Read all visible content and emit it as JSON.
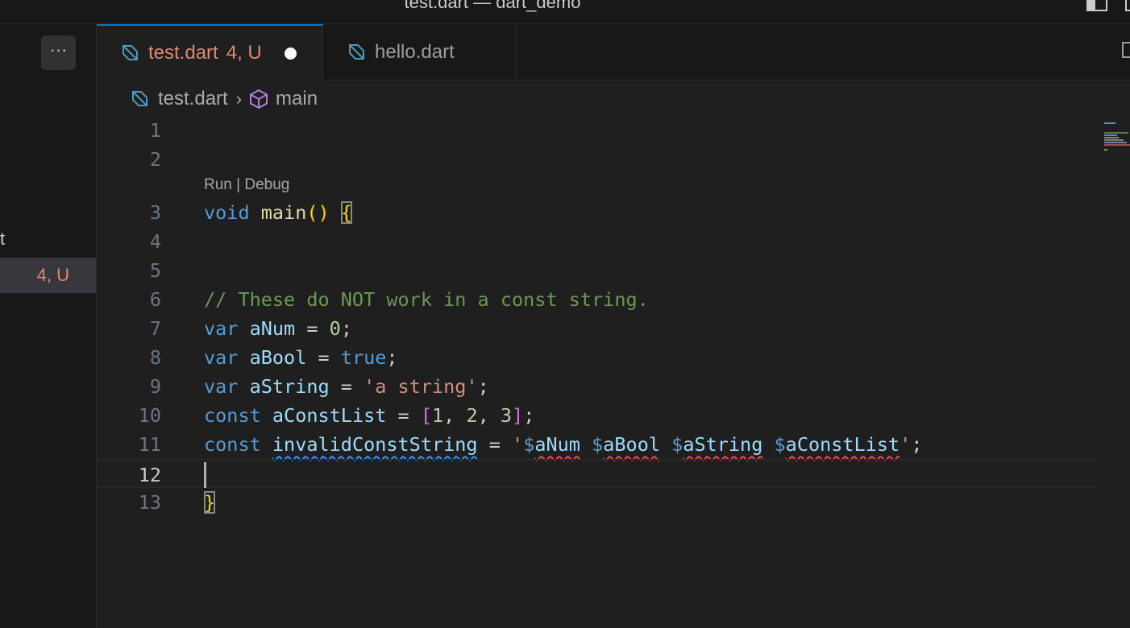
{
  "window": {
    "title": "test.dart — dart_demo"
  },
  "sidebar": {
    "more_label": "···",
    "fragment": "t",
    "item_status": "4, U"
  },
  "tabs": [
    {
      "label": "test.dart",
      "status": "4, U",
      "dirty": true,
      "active": true
    },
    {
      "label": "hello.dart",
      "active": false
    }
  ],
  "breadcrumb": {
    "file": "test.dart",
    "separator": "›",
    "symbol": "main"
  },
  "editor": {
    "codelens": "Run | Debug",
    "current_line": 12,
    "line_numbers": [
      "1",
      "2",
      "3",
      "4",
      "5",
      "6",
      "7",
      "8",
      "9",
      "10",
      "11",
      "12",
      "13"
    ],
    "code": {
      "l3": {
        "kw": "void",
        "fn": "main",
        "parens": "()",
        "brace": "{"
      },
      "l6": "// These do NOT work in a const string.",
      "l7": {
        "kw": "var",
        "name": "aNum",
        "eq": " = ",
        "value": "0",
        "end": ";"
      },
      "l8": {
        "kw": "var",
        "name": "aBool",
        "eq": " = ",
        "value": "true",
        "end": ";"
      },
      "l9": {
        "kw": "var",
        "name": "aString",
        "eq": " = ",
        "value": "'a string'",
        "end": ";"
      },
      "l10": {
        "kw": "const",
        "name": "aConstList",
        "eq": " = ",
        "open": "[",
        "v1": "1",
        "v2": "2",
        "v3": "3",
        "comma": ", ",
        "close": "]",
        "end": ";"
      },
      "l11": {
        "kw": "const",
        "name": "invalidConstString",
        "eq": " = ",
        "q": "'",
        "d": "$",
        "n1": "aNum",
        "n2": "aBool",
        "n3": "aString",
        "n4": "aConstList",
        "sp": " ",
        "end": ";"
      },
      "l13": {
        "brace": "}"
      }
    }
  },
  "colors": {
    "accent": "#0078d4",
    "modified": "#e2866e",
    "error": "#f14c4c",
    "warning_info": "#3794ff"
  }
}
